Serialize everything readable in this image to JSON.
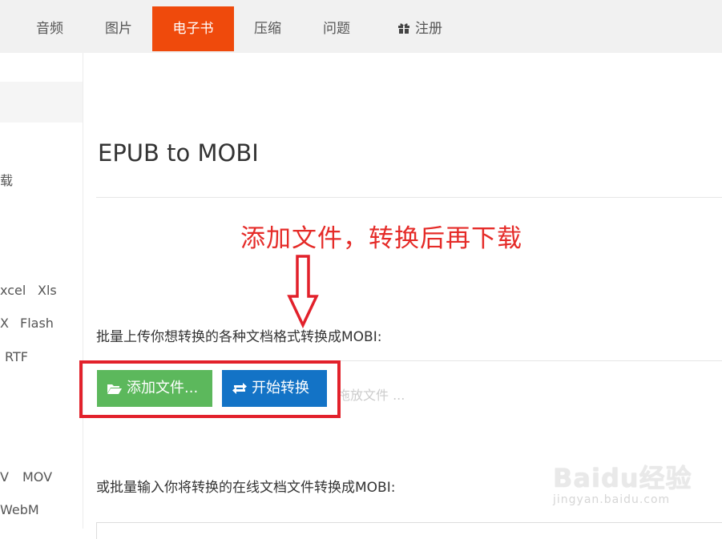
{
  "nav": {
    "tabs": [
      {
        "label": "音频"
      },
      {
        "label": "图片"
      },
      {
        "label": "电子书"
      },
      {
        "label": "压缩"
      },
      {
        "label": "问题"
      },
      {
        "label": "注册"
      }
    ]
  },
  "sidebar": {
    "fragments": [
      "载",
      "xcel",
      "Xls",
      "X",
      "Flash",
      "RTF",
      "V",
      "MOV",
      "WebM"
    ]
  },
  "main": {
    "title": "EPUB to MOBI",
    "annotation": "添加文件，转换后再下载",
    "upload_label": "批量上传你想转换的各种文档格式转换成MOBI:",
    "add_button": "添加文件...",
    "start_button": "开始转换",
    "drop_hint": "拖放文件 ...",
    "url_label": "或批量输入你将转换的在线文档文件转换成MOBI:"
  },
  "watermark": {
    "brand": "Baidu经验",
    "url": "jingyan.baidu.com"
  },
  "colors": {
    "active_tab": "#ef4a0c",
    "add_button": "#5cb85c",
    "start_button": "#1373c6",
    "annotation": "#e52b28"
  }
}
